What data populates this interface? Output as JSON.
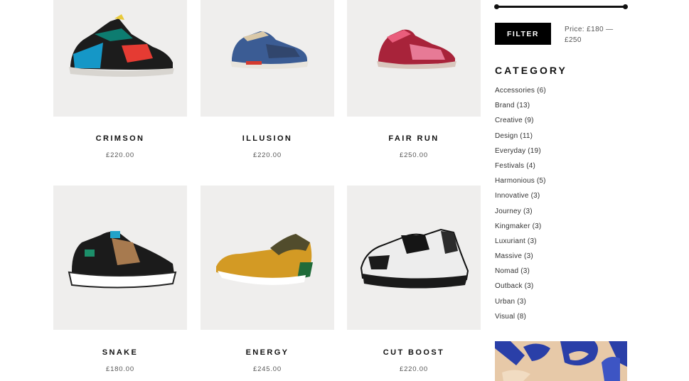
{
  "products": [
    {
      "name": "CRIMSON",
      "price": "£220.00"
    },
    {
      "name": "ILLUSION",
      "price": "£220.00"
    },
    {
      "name": "FAIR RUN",
      "price": "£250.00"
    },
    {
      "name": "SNAKE",
      "price": "£180.00"
    },
    {
      "name": "ENERGY",
      "price": "£245.00"
    },
    {
      "name": "CUT BOOST",
      "price": "£220.00"
    }
  ],
  "sidebar": {
    "filter_button": "FILTER",
    "price_range": "Price: £180 — £250",
    "category_title": "CATEGORY",
    "categories": [
      "Accessories (6)",
      "Brand (13)",
      "Creative (9)",
      "Design (11)",
      "Everyday (19)",
      "Festivals (4)",
      "Harmonious (5)",
      "Innovative (3)",
      "Journey (3)",
      "Kingmaker (3)",
      "Luxuriant (3)",
      "Massive (3)",
      "Nomad (3)",
      "Outback (3)",
      "Urban (3)",
      "Visual (8)"
    ]
  },
  "colors": {
    "accent": "#000000",
    "thumb_bg": "#efeeed",
    "banner_blue": "#2a3fa8",
    "banner_bg": "#e7c9a8"
  }
}
